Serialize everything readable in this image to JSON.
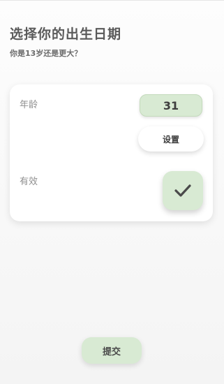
{
  "header": {
    "title": "选择你的出生日期",
    "subtitle": "你是13岁还是更大？"
  },
  "card": {
    "age_label": "年龄",
    "age_value": "31",
    "set_button_label": "设置",
    "valid_label": "有效",
    "valid_checked": true
  },
  "footer": {
    "submit_label": "提交"
  },
  "colors": {
    "accent_green": "#d8ead3",
    "text_dark": "#3e3e3e",
    "label_gray": "#8f8f8f"
  }
}
